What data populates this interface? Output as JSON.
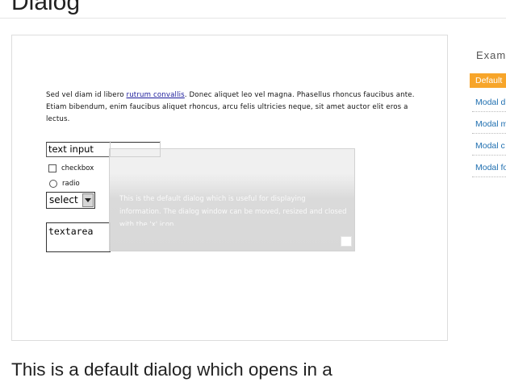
{
  "page": {
    "title": "Dialog",
    "bottom_text": "This is a default dialog which opens in a"
  },
  "demo": {
    "paragraph_before_link": "Sed vel diam id libero ",
    "paragraph_link": "rutrum convallis",
    "paragraph_after_link": ". Donec aliquet leo vel magna. Phasellus rhoncus faucibus ante. Etiam bibendum, enim faucibus aliquet rhoncus, arcu felis ultricies neque, sit amet auctor elit eros a lectus.",
    "text_input_value": "text input",
    "checkbox_label": "checkbox",
    "radio_label": "radio",
    "select_value": "select",
    "textarea_value": "textarea",
    "dialog_text": "This is the default dialog which is useful for displaying information. The dialog window can be moved, resized and closed with the 'x' icon."
  },
  "sidebar": {
    "heading": "Exam",
    "items": [
      {
        "label": "Default",
        "active": true
      },
      {
        "label": "Modal di",
        "active": false
      },
      {
        "label": "Modal m",
        "active": false
      },
      {
        "label": "Modal c",
        "active": false
      },
      {
        "label": "Modal fo",
        "active": false
      }
    ]
  },
  "colors": {
    "accent": "#f7a52a",
    "link": "#1f6fb0"
  },
  "icons": {
    "select_arrow": "chevron-down-icon",
    "dialog_close": "close-icon"
  }
}
